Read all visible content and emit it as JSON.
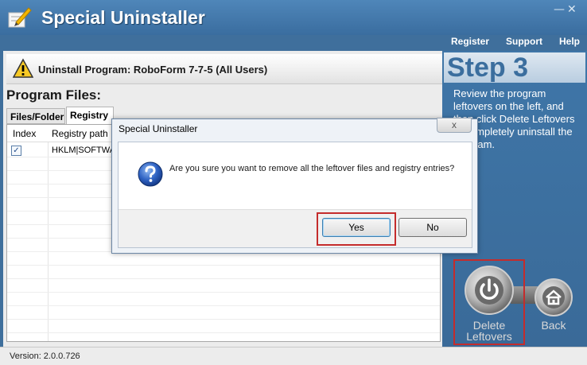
{
  "app": {
    "title": "Special Uninstaller",
    "minimize": "—",
    "close": "✕"
  },
  "topmenu": {
    "register": "Register",
    "support": "Support",
    "help": "Help"
  },
  "uninstall_bar": {
    "text": "Uninstall Program: RoboForm 7-7-5 (All Users)"
  },
  "program_files": {
    "heading": "Program Files:",
    "tabs": [
      {
        "label": "Files/Folder",
        "active": false
      },
      {
        "label": "Registry",
        "active": true
      }
    ],
    "columns": [
      "Index",
      "Registry path"
    ],
    "rows": [
      {
        "checked": true,
        "path": "HKLM|SOFTWA"
      }
    ]
  },
  "step": {
    "title": "Step 3",
    "description": "Review the program leftovers on the left, and then click Delete Leftovers to completely uninstall the program."
  },
  "actions": {
    "delete_label": "Delete Leftovers",
    "back_label": "Back"
  },
  "dialog": {
    "title": "Special Uninstaller",
    "close": "x",
    "message": "Are you sure you want to remove all the leftover files and registry entries?",
    "yes": "Yes",
    "no": "No"
  },
  "status": {
    "version": "Version: 2.0.0.726"
  },
  "colors": {
    "titlebar": "#4f86b9",
    "right_panel": "#3f76a8",
    "highlight": "#c42c2c"
  }
}
